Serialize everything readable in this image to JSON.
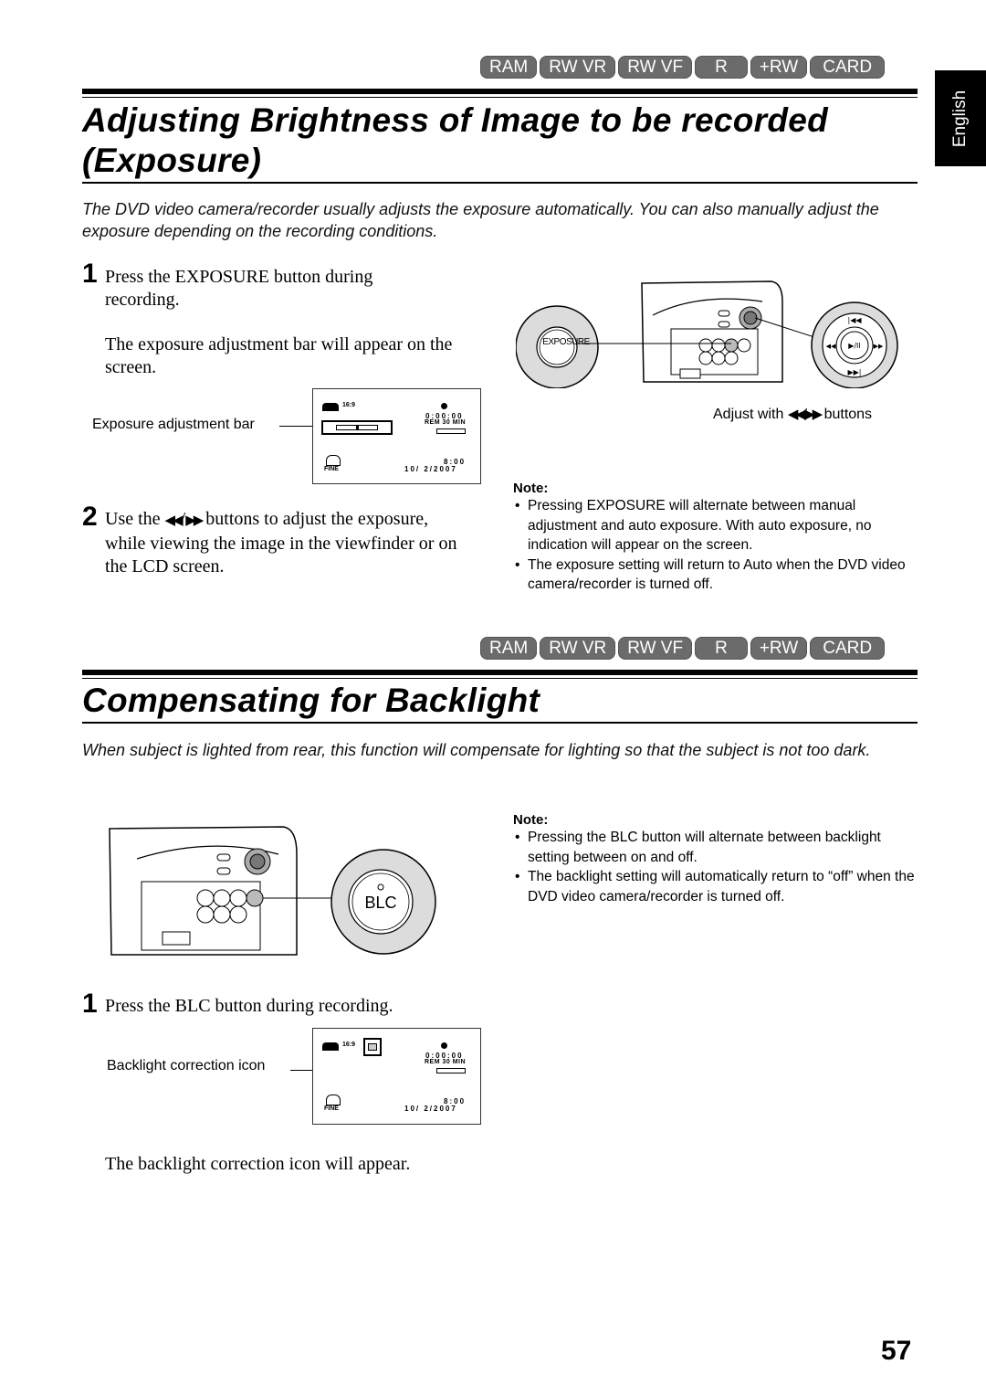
{
  "disc_badges": [
    "RAM",
    "RW VR",
    "RW VF",
    "R",
    "+RW",
    "CARD"
  ],
  "language_tab": "English",
  "section1": {
    "title_line1": "Adjusting Brightness of Image to be recorded",
    "title_line2": "(Exposure)",
    "intro": "The DVD video camera/recorder usually adjusts the exposure automatically. You can also manually adjust the exposure depending on the recording conditions.",
    "steps": [
      {
        "num": "1",
        "text": "Press the EXPOSURE button during recording.",
        "result": "The exposure adjustment bar will appear on the screen."
      },
      {
        "num": "2",
        "text_before": "Use the ",
        "icon_rew": "◀◀",
        "slash": "/",
        "icon_ff": "▶▶",
        "text_after": " buttons to adjust the exposure, while viewing the image in the viewfinder or on the LCD screen."
      }
    ],
    "lcd_callout": "Exposure adjustment bar",
    "exposure_bar_level": 0.5,
    "illustration": {
      "button_label": "EXPOSURE",
      "caption_before": "Adjust with ",
      "caption_icons": "◀◀/▶▶",
      "caption_after": " buttons",
      "dpad": {
        "up": "|◀◀",
        "down": "▶▶|",
        "left": "◀◀",
        "right": "▶▶",
        "center": "▶/II"
      }
    },
    "note": {
      "title": "Note:",
      "items": [
        "Pressing EXPOSURE will alternate between manual adjustment and auto exposure. With auto exposure, no indication will appear on the screen.",
        "The exposure setting will return to Auto when the DVD video camera/recorder is turned off."
      ]
    }
  },
  "section2": {
    "title": "Compensating for Backlight",
    "intro": "When subject is lighted from rear, this function will compensate for lighting so that the subject is not too dark.",
    "steps": [
      {
        "num": "1",
        "text": "Press the BLC button during recording.",
        "result": "The backlight correction icon will appear."
      }
    ],
    "lcd_callout": "Backlight correction icon",
    "illustration": {
      "button_label": "BLC"
    },
    "note": {
      "title": "Note:",
      "items": [
        "Pressing the BLC button will alternate between backlight setting between on and off.",
        "The backlight setting will automatically return to “off” when the DVD video camera/recorder is turned off."
      ]
    }
  },
  "lcd_display": {
    "aspect": "16:9",
    "counter": "0:00:00",
    "remaining": "REM 30 MIN",
    "quality": "FINE",
    "time": "8:00",
    "date": "10/ 2/2007"
  },
  "page_number": "57"
}
